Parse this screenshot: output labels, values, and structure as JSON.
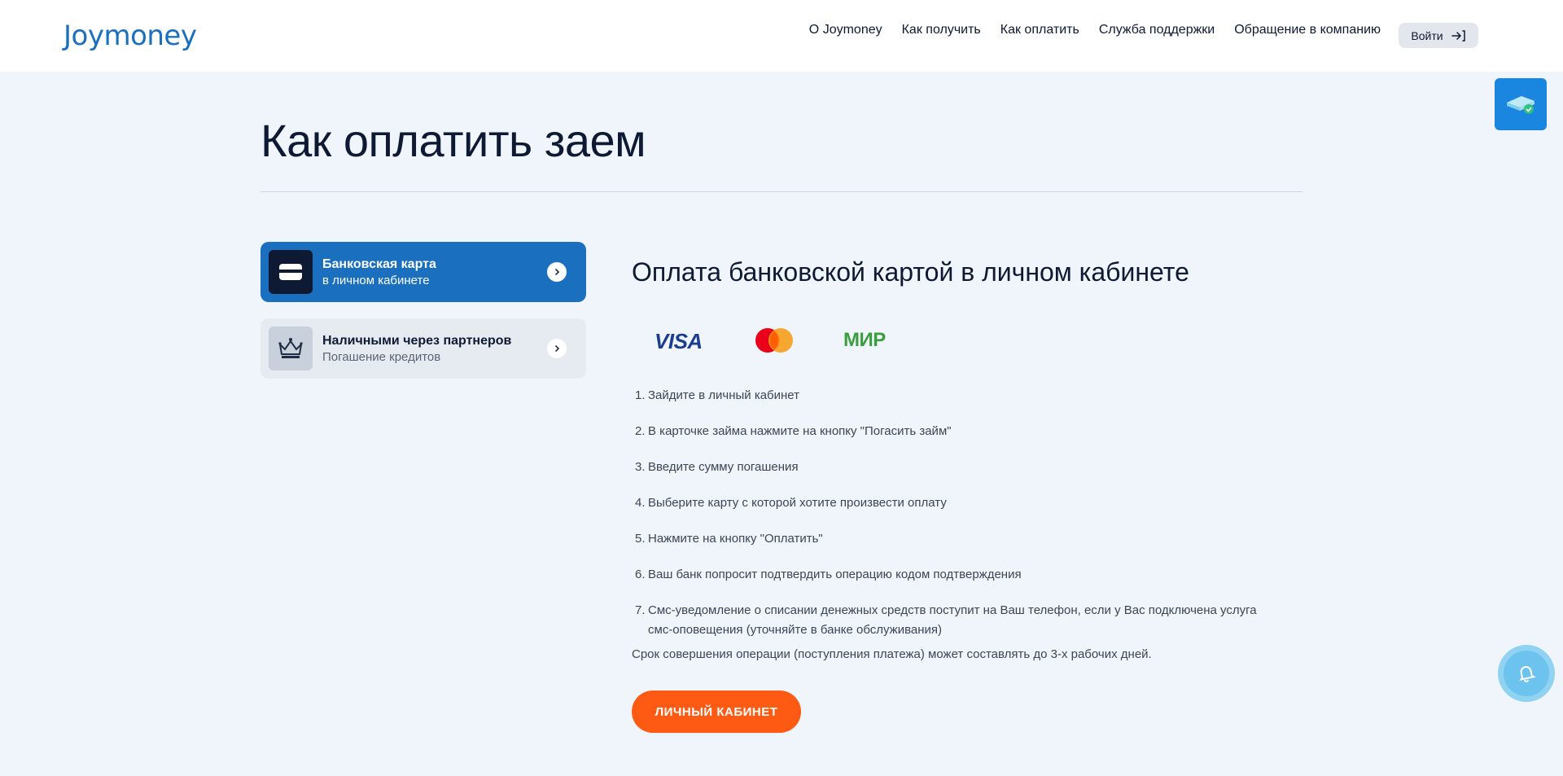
{
  "header": {
    "logo": "Joymoney",
    "nav": [
      "О Joymoney",
      "Как получить",
      "Как оплатить",
      "Служба поддержки",
      "Обращение в компанию"
    ],
    "login_label": "Войти"
  },
  "page": {
    "title": "Как оплатить заем"
  },
  "tabs": [
    {
      "title": "Банковская карта",
      "subtitle": "в личном кабинете",
      "icon": "credit-card-icon",
      "active": true
    },
    {
      "title": "Наличными через партнеров",
      "subtitle": "Погашение кредитов",
      "icon": "crown-icon",
      "active": false
    }
  ],
  "content": {
    "title": "Оплата банковской картой в личном кабинете",
    "payment_logos": [
      "VISA",
      "mastercard",
      "МИР"
    ],
    "steps": [
      "Зайдите в личный кабинет",
      "В карточке займа нажмите на кнопку \"Погасить займ\"",
      "Введите сумму погашения",
      "Выберите карту с которой хотите произвести оплату",
      "Нажмите на кнопку \"Оплатить\"",
      "Ваш банк попросит подтвердить операцию кодом подтверждения",
      "Смс-уведомление о списании денежных средств поступит на Ваш телефон, если у Вас подключена услуга смс-оповещения (уточняйте в банке обслуживания)"
    ],
    "note": "Срок совершения операции (поступления платежа) может составлять до 3-х рабочих дней.",
    "button_label": "ЛИЧНЫЙ КАБИНЕТ"
  },
  "colors": {
    "brand_blue": "#1a6fbf",
    "accent_orange": "#ff5a13",
    "background": "#f0f5fb"
  }
}
